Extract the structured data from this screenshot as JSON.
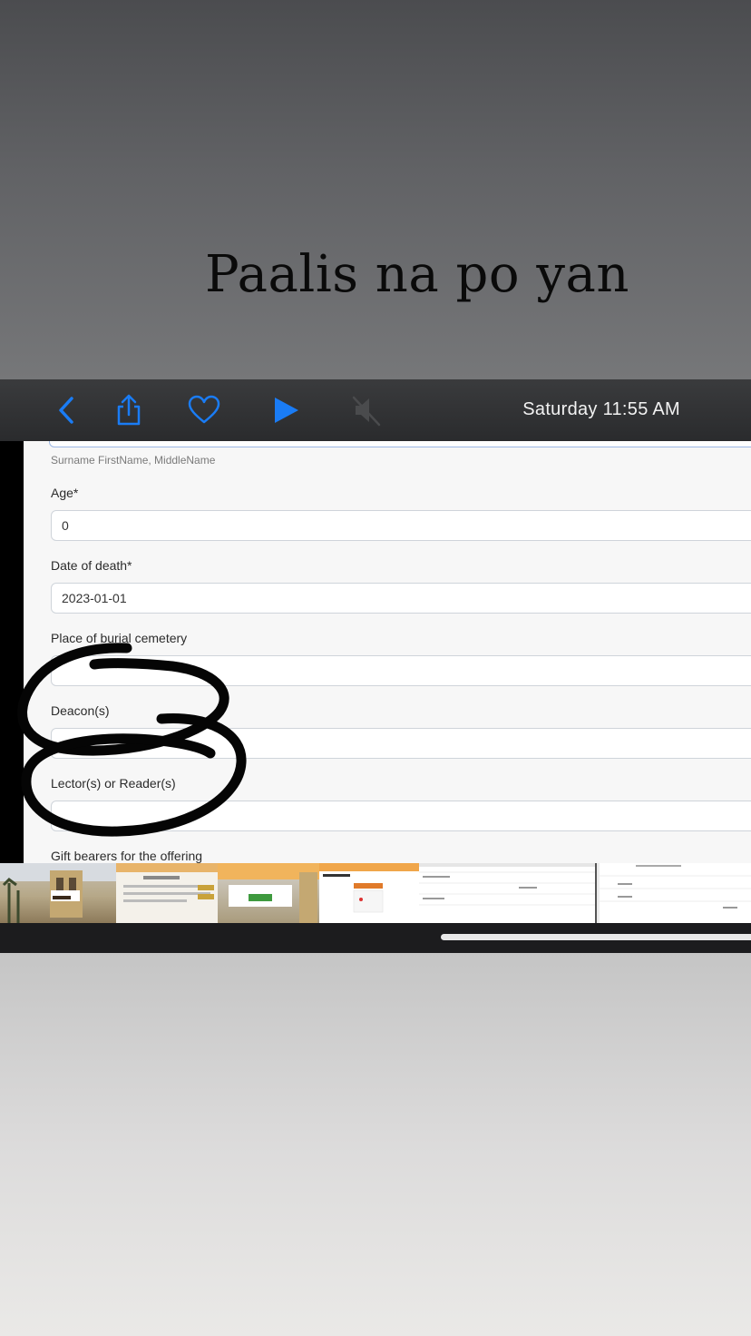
{
  "story": {
    "caption": "Paalis na po yan"
  },
  "toolbar": {
    "icons": [
      "back-chevron-icon",
      "share-icon",
      "heart-icon",
      "play-icon",
      "muted-speaker-icon"
    ],
    "datetime": "Saturday  11:55 AM",
    "accent": "#1a7cf5"
  },
  "form": {
    "name_helper": "Surname FirstName, MiddleName",
    "age_label": "Age*",
    "age_value": "0",
    "date_label": "Date of death*",
    "date_value": "2023-01-01",
    "burial_label": "Place of burial cemetery",
    "burial_value": "",
    "deacon_label": "Deacon(s)",
    "deacon_value": "",
    "lector_label": "Lector(s) or Reader(s)",
    "lector_value": "",
    "gift_label": "Gift bearers for the offering"
  }
}
